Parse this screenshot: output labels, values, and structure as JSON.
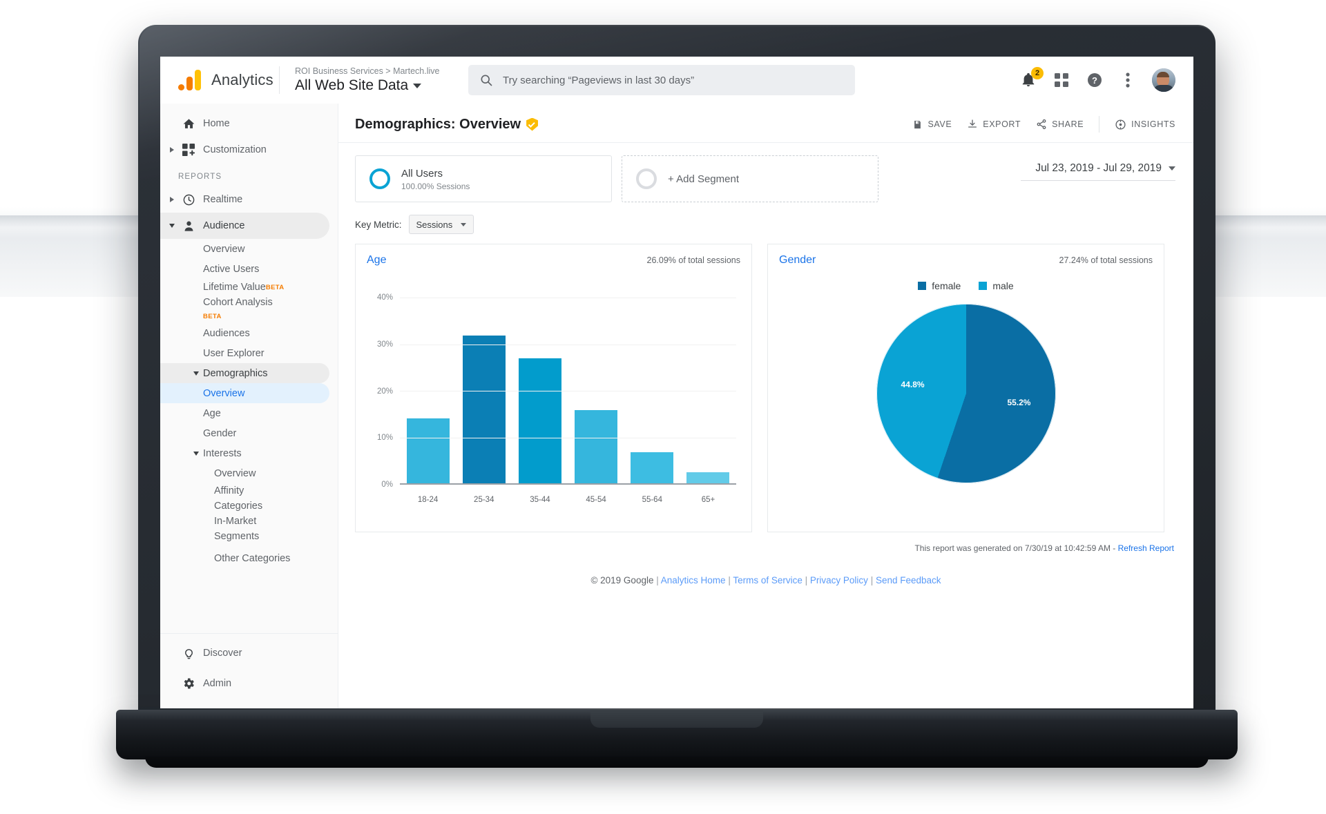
{
  "topbar": {
    "brand": "Analytics",
    "account_breadcrumb": "ROI Business Services > Martech.live",
    "property_title": "All Web Site Data",
    "search_placeholder": "Try searching “Pageviews in last 30 days”",
    "search_value": "",
    "notification_count": "2",
    "icons": {
      "search": "search-icon",
      "bell": "notifications-bell-icon",
      "apps": "apps-grid-icon",
      "help": "help-circle-icon",
      "more": "more-vertical-icon",
      "avatar": "user-avatar"
    }
  },
  "sidebar": {
    "section_label": "REPORTS",
    "top_items": [
      {
        "label": "Home",
        "icon": "home-icon",
        "expandable": false
      },
      {
        "label": "Customization",
        "icon": "customization-icon",
        "expandable": true
      }
    ],
    "report_items": [
      {
        "label": "Realtime",
        "icon": "clock-icon",
        "expandable": true,
        "active": false
      },
      {
        "label": "Audience",
        "icon": "person-icon",
        "expandable": true,
        "active": true
      }
    ],
    "audience_children": [
      {
        "label": "Overview",
        "badge": ""
      },
      {
        "label": "Active Users",
        "badge": ""
      },
      {
        "label": "Lifetime Value",
        "badge": "BETA",
        "badge_pos": "sup"
      },
      {
        "label": "Cohort Analysis",
        "badge": "BETA",
        "badge_pos": "below"
      },
      {
        "label": "Audiences",
        "badge": ""
      },
      {
        "label": "User Explorer",
        "badge": ""
      }
    ],
    "demographics": {
      "label": "Demographics",
      "children": [
        {
          "label": "Overview",
          "selected": true
        },
        {
          "label": "Age",
          "selected": false
        },
        {
          "label": "Gender",
          "selected": false
        }
      ]
    },
    "interests": {
      "label": "Interests",
      "children": [
        {
          "label": "Overview"
        },
        {
          "label": "Affinity"
        },
        {
          "label": "Categories"
        },
        {
          "label": "In-Market"
        },
        {
          "label": "Segments"
        },
        {
          "label": "Other Categories"
        }
      ]
    },
    "bottom_items": [
      {
        "label": "Discover",
        "icon": "lightbulb-icon"
      },
      {
        "label": "Admin",
        "icon": "gear-icon"
      }
    ]
  },
  "page": {
    "title": "Demographics: Overview",
    "verified_icon": "shield-check-icon",
    "actions": [
      {
        "label": "SAVE",
        "icon": "save-icon"
      },
      {
        "label": "EXPORT",
        "icon": "export-download-icon"
      },
      {
        "label": "SHARE",
        "icon": "share-icon"
      },
      {
        "label": "INSIGHTS",
        "icon": "insights-icon"
      }
    ]
  },
  "segments": {
    "primary": {
      "name": "All Users",
      "sub": "100.00% Sessions"
    },
    "add_label": "+ Add Segment"
  },
  "date_range": {
    "value": "Jul 23, 2019 - Jul 29, 2019"
  },
  "key_metric": {
    "label": "Key Metric:",
    "value": "Sessions"
  },
  "report_note": {
    "text": "This report was generated on 7/30/19 at 10:42:59 AM - ",
    "link": "Refresh Report"
  },
  "footer": {
    "copyright": "© 2019 Google",
    "links": [
      "Analytics Home",
      "Terms of Service",
      "Privacy Policy",
      "Send Feedback"
    ]
  },
  "colors": {
    "accent_blue": "#1a73e8",
    "bar_dark": "#0b7fb5",
    "bar_mid": "#029ccc",
    "bar_light": "#35b6dd",
    "pie_female": "#0a6ea4",
    "pie_male": "#0aa3d4",
    "brand_orange": "#f57c00",
    "brand_amber": "#ffc107"
  },
  "chart_data": [
    {
      "type": "bar",
      "title": "Age",
      "subtitle": "26.09% of total sessions",
      "categories": [
        "18-24",
        "25-34",
        "35-44",
        "45-54",
        "55-64",
        "65+"
      ],
      "values": [
        14.3,
        32.0,
        27.2,
        16.0,
        7.0,
        2.7
      ],
      "bar_colors": [
        "#35b6dd",
        "#0b7fb5",
        "#029ccc",
        "#35b6dd",
        "#3dbde2",
        "#62cbe8"
      ],
      "xlabel": "",
      "ylabel": "",
      "ylim": [
        0,
        43
      ],
      "yticks": [
        0,
        10,
        20,
        30,
        40
      ],
      "ytick_labels": [
        "0%",
        "10%",
        "20%",
        "30%",
        "40%"
      ],
      "grid": true,
      "legend": "none"
    },
    {
      "type": "pie",
      "title": "Gender",
      "subtitle": "27.24% of total sessions",
      "categories": [
        "female",
        "male"
      ],
      "values": [
        55.2,
        44.8
      ],
      "labels": [
        "55.2%",
        "44.8%"
      ],
      "slice_colors": [
        "#0a6ea4",
        "#0aa3d4"
      ],
      "legend": "top"
    }
  ]
}
